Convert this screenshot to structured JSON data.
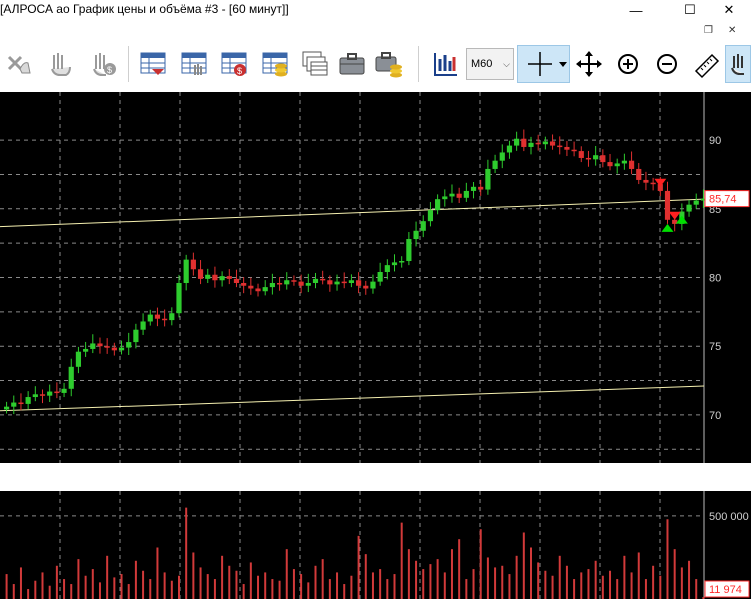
{
  "window": {
    "title": "[АЛРОСА ао График цены и объёма #3 - [60 минут]]",
    "controls": [
      "minimize-icon",
      "maximize-icon",
      "close-icon"
    ],
    "mdi_controls": [
      "restore-icon",
      "close-icon"
    ]
  },
  "toolbar": {
    "buttons": [
      {
        "name": "cancel-orders-icon"
      },
      {
        "name": "hand-orders-icon"
      },
      {
        "name": "hand-money-icon"
      },
      {
        "name": "orders-table-icon"
      },
      {
        "name": "trades-table-icon"
      },
      {
        "name": "money-table-icon"
      },
      {
        "name": "coins-table-icon"
      },
      {
        "name": "stacked-tables-icon"
      },
      {
        "name": "briefcase-icon"
      },
      {
        "name": "portfolio-coins-icon"
      },
      {
        "name": "chart-bars-icon"
      },
      {
        "name": "crosshair-icon"
      },
      {
        "name": "move-icon"
      },
      {
        "name": "zoom-in-icon"
      },
      {
        "name": "zoom-out-icon"
      },
      {
        "name": "ruler-icon"
      },
      {
        "name": "hand-icon"
      }
    ],
    "timeframe": "M60"
  },
  "colors": {
    "background": "#000000",
    "grid": "#8a8a8a",
    "candle_up": "#2ecc2e",
    "candle_down": "#e03030",
    "trendline": "#f5f0b0",
    "volume": "#d23a3a",
    "price_label": "#ff2a2a",
    "signal_up": "#00e000",
    "signal_down": "#ff2020"
  },
  "chart_data": [
    {
      "type": "candlestick",
      "title": "",
      "ylim": [
        66.5,
        93.5
      ],
      "y_ticks": [
        "90",
        "85",
        "80",
        "75",
        "70"
      ],
      "last_price_label": "85,74",
      "closes": [
        70.6,
        70.9,
        70.8,
        71.3,
        71.5,
        71.4,
        71.7,
        71.6,
        71.9,
        73.5,
        74.6,
        74.8,
        75.2,
        75.0,
        74.9,
        74.7,
        74.9,
        75.3,
        76.2,
        76.8,
        77.3,
        77.0,
        76.9,
        77.4,
        79.6,
        81.3,
        80.6,
        79.9,
        80.2,
        79.8,
        80.1,
        79.9,
        79.6,
        79.4,
        79.2,
        79.0,
        79.3,
        79.6,
        79.5,
        79.8,
        79.7,
        79.4,
        79.6,
        79.9,
        79.8,
        79.5,
        79.7,
        79.6,
        79.8,
        79.4,
        79.2,
        79.7,
        80.4,
        80.9,
        81.1,
        81.2,
        82.8,
        83.4,
        84.1,
        84.9,
        85.7,
        85.9,
        86.1,
        85.8,
        86.3,
        86.6,
        86.4,
        87.9,
        88.5,
        89.1,
        89.6,
        90.1,
        89.5,
        89.8,
        89.7,
        89.9,
        89.6,
        89.5,
        89.3,
        89.2,
        88.7,
        88.6,
        88.9,
        88.4,
        88.1,
        88.3,
        88.5,
        87.9,
        87.1,
        86.9,
        86.8,
        86.3,
        84.2,
        83.9,
        84.8,
        85.3,
        85.6,
        85.74
      ],
      "trendlines": [
        {
          "from": [
            0,
            83.7
          ],
          "to": [
            97,
            85.7
          ]
        },
        {
          "from": [
            0,
            70.3
          ],
          "to": [
            97,
            72.1
          ]
        }
      ],
      "signals": [
        {
          "index": 91,
          "direction": "sell"
        },
        {
          "index": 92,
          "direction": "buy"
        },
        {
          "index": 93,
          "direction": "sell"
        },
        {
          "index": 94,
          "direction": "buy"
        }
      ]
    },
    {
      "type": "bar",
      "title": "",
      "ylim": [
        0,
        650000
      ],
      "y_ticks": [
        "500 000"
      ],
      "last_volume_label": "11 974",
      "values": [
        150000,
        90000,
        190000,
        60000,
        110000,
        160000,
        80000,
        200000,
        120000,
        90000,
        240000,
        140000,
        180000,
        100000,
        260000,
        130000,
        150000,
        90000,
        230000,
        170000,
        120000,
        310000,
        160000,
        110000,
        140000,
        550000,
        280000,
        190000,
        150000,
        120000,
        260000,
        200000,
        170000,
        90000,
        220000,
        140000,
        160000,
        120000,
        110000,
        300000,
        180000,
        150000,
        100000,
        200000,
        240000,
        120000,
        160000,
        90000,
        140000,
        380000,
        270000,
        160000,
        180000,
        120000,
        150000,
        460000,
        300000,
        230000,
        180000,
        210000,
        240000,
        160000,
        300000,
        360000,
        120000,
        180000,
        420000,
        250000,
        190000,
        200000,
        150000,
        260000,
        400000,
        310000,
        220000,
        170000,
        140000,
        260000,
        200000,
        120000,
        160000,
        180000,
        230000,
        140000,
        170000,
        120000,
        260000,
        160000,
        280000,
        120000,
        200000,
        140000,
        480000,
        300000,
        190000,
        230000,
        120000,
        11974
      ]
    }
  ]
}
